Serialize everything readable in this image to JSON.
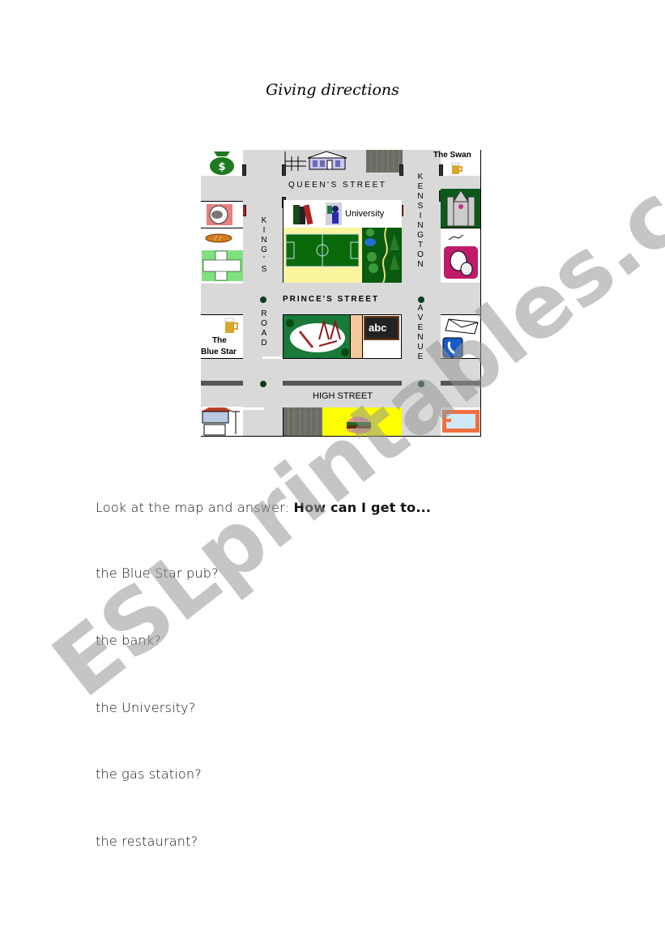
{
  "document": {
    "title": "Giving directions",
    "watermark": "ESLprintables.com"
  },
  "map": {
    "streets": {
      "queens": "QUEEN'S STREET",
      "princes": "PRINCE'S STREET",
      "high": "HIGH STREET",
      "kings_road": "KING'S ROAD",
      "kings_road_letters": [
        "K",
        "I",
        "N",
        "G",
        "'",
        "S"
      ],
      "road_letters": [
        "R",
        "O",
        "A",
        "D"
      ],
      "kensington_letters": [
        "K",
        "E",
        "N",
        "S",
        "I",
        "N",
        "G",
        "T",
        "O",
        "N"
      ],
      "avenue_letters": [
        "A",
        "V",
        "E",
        "N",
        "U",
        "E"
      ]
    },
    "places": {
      "swan": "The Swan",
      "university": "University",
      "blue_star_line1": "The",
      "blue_star_line2": "Blue Star",
      "school_board": "abc"
    },
    "icons": [
      "bank-money-bag",
      "house",
      "parking-lot",
      "beer-mug",
      "cathedral",
      "pet-shop",
      "bakery",
      "hospital-cross",
      "books-library",
      "football-pitch",
      "park-trees",
      "theatre-masks",
      "playground",
      "school-blackboard",
      "post-office",
      "telephone",
      "gas-station",
      "restaurant-burger",
      "swimming-pool"
    ]
  },
  "questions": {
    "prompt_plain": "Look at the map and answer: ",
    "prompt_bold": "How can I get to...",
    "items": [
      "the Blue Star pub?",
      "the bank?",
      "the University?",
      "the gas station?",
      "the restaurant?"
    ]
  }
}
